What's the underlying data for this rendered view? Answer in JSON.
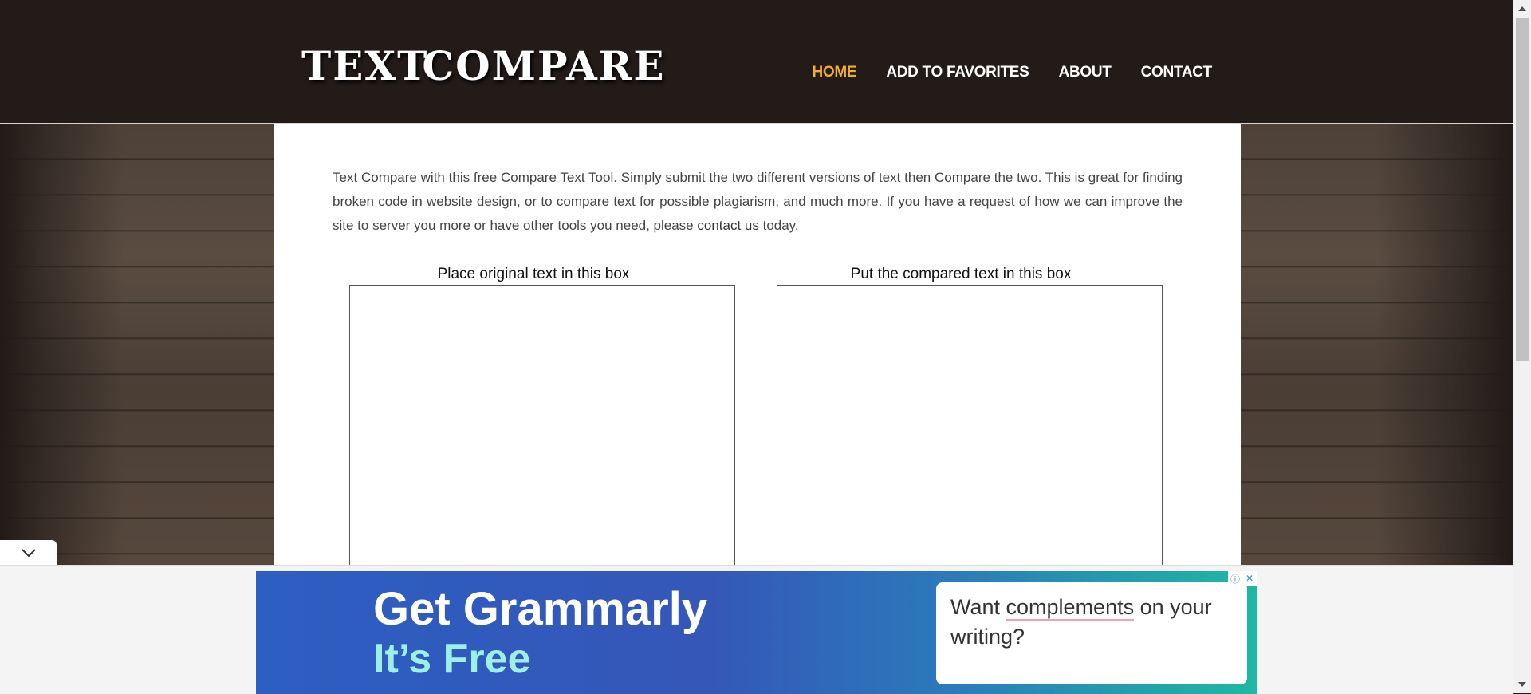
{
  "header": {
    "logo": {
      "text_left": "TEXT",
      "text_right": "COMPARE",
      "icon": "swap-arrows-icon",
      "colors": {
        "arrow_top": "#3aa7c9",
        "arrow_bottom": "#8cc63f"
      }
    },
    "nav": [
      {
        "label": "HOME",
        "active": true
      },
      {
        "label": "ADD TO FAVORITES",
        "active": false
      },
      {
        "label": "ABOUT",
        "active": false
      },
      {
        "label": "CONTACT",
        "active": false
      }
    ]
  },
  "main": {
    "intro_before_link": "Text Compare with this free Compare Text Tool. Simply submit the two different versions of text then Compare the two. This is great for finding broken code in website design, or to compare text for possible plagiarism, and much more. If you have a request of how we can improve the site to server you more or have other tools you need, please ",
    "intro_link": "contact us",
    "intro_after_link": " today.",
    "original_box_label": "Place original text in this box",
    "original_box_value": "",
    "compared_box_label": "Put the compared text in this box",
    "compared_box_value": ""
  },
  "collapse_tab": {
    "icon": "chevron-down-icon"
  },
  "ad": {
    "headline": "Get Grammarly",
    "subheadline": "It’s Free",
    "card_prefix": "Want ",
    "card_underlined": "complements",
    "card_suffix": " on your writing?",
    "info_icon": "ⓘ",
    "close_icon": "✕"
  },
  "colors": {
    "header_bg": "#231b18",
    "nav_active": "#f4ad28",
    "ad_blue": "#2d5ec2",
    "ad_teal": "#1fb8a2"
  }
}
